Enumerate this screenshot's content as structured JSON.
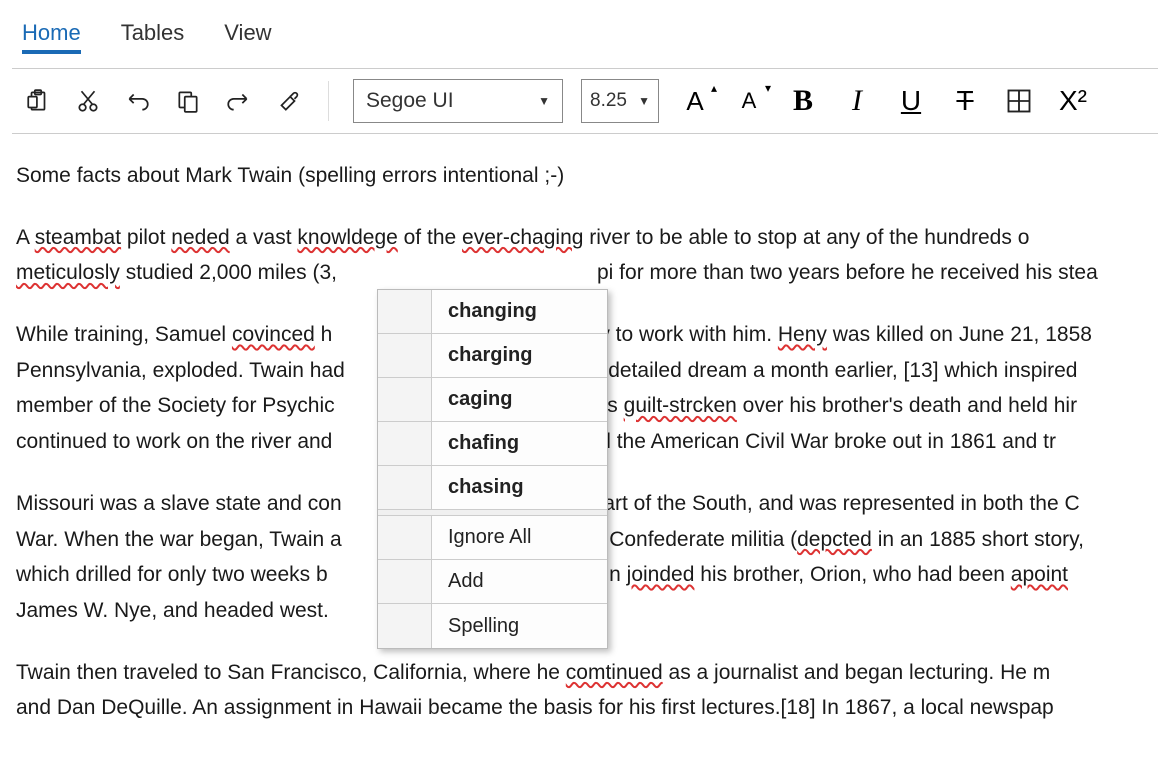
{
  "tabs": {
    "home": "Home",
    "tables": "Tables",
    "view": "View"
  },
  "toolbar": {
    "font_name": "Segoe UI",
    "font_size": "8.25",
    "increase_label": "A",
    "decrease_label": "A",
    "bold": "B",
    "italic": "I",
    "underline": "U",
    "strike": "T",
    "super": "X²"
  },
  "document": {
    "p1_a": "Some facts about Mark Twain (spelling errors intentional ;-)",
    "p2_a": "A ",
    "p2_b": "steambat",
    "p2_c": " pilot ",
    "p2_d": "neded",
    "p2_e": " a vast ",
    "p2_f": "knowldege",
    "p2_g": " of the ",
    "p2_h": "ever-chaging",
    "p2_i": " river to be able to stop at any of the hundreds o",
    "p2_j": "meticulosly",
    "p2_k": " studied 2,000 miles (3,",
    "p2_l": "pi for more than two years before he received his stea",
    "p3_a": "While training, Samuel ",
    "p3_b": "covinced",
    "p3_c": " h",
    "p3_d": "ry to work with him. ",
    "p3_e": "Heny",
    "p3_f": " was killed on June 21, 1858",
    "p3_g": "Pennsylvania, exploded. Twain had",
    "p3_h": " a detailed dream a month earlier, [13] which inspired ",
    "p3_i": "member of the Society for Psychic",
    "p3_j": " was ",
    "p3_k": "guilt-strcken",
    "p3_l": " over his brother's death and held hir",
    "p3_m": "continued to work on the river and",
    "p3_n": "until the American Civil War broke out in 1861 and tr",
    "p4_a": "Missouri was a slave state and con",
    "p4_b": "part of the South, and was represented in both the C",
    "p4_c": "War. When the war began, Twain a",
    "p4_d": "a Confederate militia (",
    "p4_e": "depcted",
    "p4_f": " in an 1885 short story,",
    "p4_g": "which drilled for only two weeks b",
    "p4_h": "wain ",
    "p4_i": "joinded",
    "p4_j": " his brother, Orion, who had been ",
    "p4_k": "apoint",
    "p4_l": "James W. Nye, and headed west.",
    "p5_a": "Twain then traveled to San Francisco, California, where he ",
    "p5_b": "comtinued",
    "p5_c": " as a journalist and began lecturing. He m",
    "p5_d": "and Dan DeQuille. An assignment in Hawaii became the basis for his first lectures.[18] In 1867, a local newspap"
  },
  "menu": {
    "suggestions": {
      "s0": "changing",
      "s1": "charging",
      "s2": "caging",
      "s3": "chafing",
      "s4": "chasing"
    },
    "ignore": "Ignore All",
    "add": "Add",
    "spelling": "Spelling"
  }
}
